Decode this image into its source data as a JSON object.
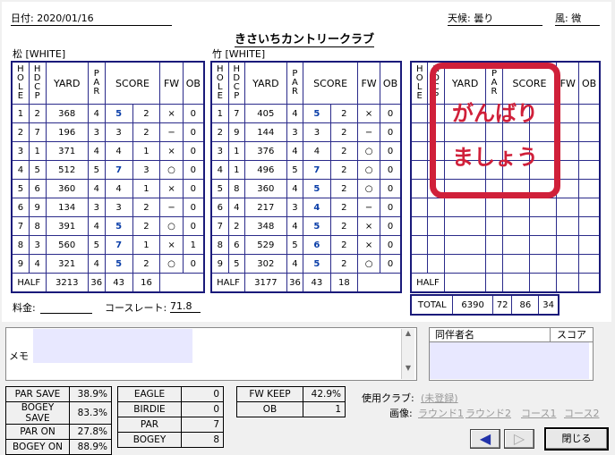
{
  "header": {
    "date_label": "日付: 2020/01/16",
    "weather_label": "天候: 曇り",
    "wind_label": "風: 微",
    "club_name": "きさいちカントリークラブ"
  },
  "course1": {
    "name": "松 [WHITE]",
    "rows": [
      {
        "hole": "1",
        "hdcp": "2",
        "yard": "368",
        "par": "4",
        "score": "5",
        "putt": "2",
        "fw": "×",
        "ob": "0",
        "blue": true
      },
      {
        "hole": "2",
        "hdcp": "7",
        "yard": "196",
        "par": "3",
        "score": "3",
        "putt": "2",
        "fw": "−",
        "ob": "0",
        "blue": false
      },
      {
        "hole": "3",
        "hdcp": "1",
        "yard": "371",
        "par": "4",
        "score": "4",
        "putt": "1",
        "fw": "×",
        "ob": "0",
        "blue": false
      },
      {
        "hole": "4",
        "hdcp": "5",
        "yard": "512",
        "par": "5",
        "score": "7",
        "putt": "3",
        "fw": "○",
        "ob": "0",
        "blue": true
      },
      {
        "hole": "5",
        "hdcp": "6",
        "yard": "360",
        "par": "4",
        "score": "4",
        "putt": "1",
        "fw": "×",
        "ob": "0",
        "blue": false
      },
      {
        "hole": "6",
        "hdcp": "9",
        "yard": "134",
        "par": "3",
        "score": "3",
        "putt": "2",
        "fw": "−",
        "ob": "0",
        "blue": false
      },
      {
        "hole": "7",
        "hdcp": "8",
        "yard": "391",
        "par": "4",
        "score": "5",
        "putt": "2",
        "fw": "○",
        "ob": "0",
        "blue": true
      },
      {
        "hole": "8",
        "hdcp": "3",
        "yard": "560",
        "par": "5",
        "score": "7",
        "putt": "1",
        "fw": "×",
        "ob": "1",
        "blue": true
      },
      {
        "hole": "9",
        "hdcp": "4",
        "yard": "321",
        "par": "4",
        "score": "5",
        "putt": "2",
        "fw": "○",
        "ob": "0",
        "blue": true
      }
    ],
    "half": {
      "label": "HALF",
      "yard": "3213",
      "par": "36",
      "score": "43",
      "putt": "16"
    }
  },
  "course2": {
    "name": "竹 [WHITE]",
    "rows": [
      {
        "hole": "1",
        "hdcp": "7",
        "yard": "405",
        "par": "4",
        "score": "5",
        "putt": "2",
        "fw": "×",
        "ob": "0",
        "blue": true
      },
      {
        "hole": "2",
        "hdcp": "9",
        "yard": "144",
        "par": "3",
        "score": "3",
        "putt": "2",
        "fw": "−",
        "ob": "0",
        "blue": false
      },
      {
        "hole": "3",
        "hdcp": "1",
        "yard": "376",
        "par": "4",
        "score": "4",
        "putt": "2",
        "fw": "○",
        "ob": "0",
        "blue": false
      },
      {
        "hole": "4",
        "hdcp": "1",
        "yard": "496",
        "par": "5",
        "score": "7",
        "putt": "2",
        "fw": "○",
        "ob": "0",
        "blue": true
      },
      {
        "hole": "5",
        "hdcp": "8",
        "yard": "360",
        "par": "4",
        "score": "5",
        "putt": "2",
        "fw": "○",
        "ob": "0",
        "blue": true
      },
      {
        "hole": "6",
        "hdcp": "4",
        "yard": "217",
        "par": "3",
        "score": "4",
        "putt": "2",
        "fw": "−",
        "ob": "0",
        "blue": true
      },
      {
        "hole": "7",
        "hdcp": "2",
        "yard": "348",
        "par": "4",
        "score": "5",
        "putt": "2",
        "fw": "×",
        "ob": "0",
        "blue": true
      },
      {
        "hole": "8",
        "hdcp": "6",
        "yard": "529",
        "par": "5",
        "score": "6",
        "putt": "2",
        "fw": "×",
        "ob": "0",
        "blue": true
      },
      {
        "hole": "9",
        "hdcp": "5",
        "yard": "302",
        "par": "4",
        "score": "5",
        "putt": "2",
        "fw": "○",
        "ob": "0",
        "blue": true
      }
    ],
    "half": {
      "label": "HALF",
      "yard": "3177",
      "par": "36",
      "score": "43",
      "putt": "18"
    }
  },
  "course3": {
    "half_label": "HALF",
    "total": {
      "label": "TOTAL",
      "yard": "6390",
      "par": "72",
      "score": "86",
      "putt": "34"
    }
  },
  "columns": {
    "hole": "HOLE",
    "hdcp": "HDCP",
    "yard": "YARD",
    "par": "PAR",
    "score": "SCORE",
    "fw": "FW",
    "ob": "OB"
  },
  "stamp": {
    "line1": "がんばり",
    "line2": "ましょう"
  },
  "footer_left": {
    "fee_label": "料金:",
    "rating_label": "コースレート:",
    "rating_value": "71.8"
  },
  "memo_label": "メモ",
  "companions": {
    "col_name": "同伴者名",
    "col_score": "スコア"
  },
  "stats": {
    "left": [
      {
        "label": "PAR SAVE",
        "value": "38.9%"
      },
      {
        "label": "BOGEY SAVE",
        "value": "83.3%"
      },
      {
        "label": "PAR ON",
        "value": "27.8%"
      },
      {
        "label": "BOGEY ON",
        "value": "88.9%"
      }
    ],
    "mid": [
      {
        "label": "EAGLE",
        "value": "0"
      },
      {
        "label": "BIRDIE",
        "value": "0"
      },
      {
        "label": "PAR",
        "value": "7"
      },
      {
        "label": "BOGEY",
        "value": "8"
      }
    ],
    "right": [
      {
        "label": "FW KEEP",
        "value": "42.9%"
      },
      {
        "label": "OB",
        "value": "1"
      }
    ]
  },
  "club_used": {
    "label": "使用クラブ:",
    "value": "(未登録)"
  },
  "images": {
    "label": "画像:",
    "round1": "ラウンド1",
    "round2": "ラウンド2",
    "course1": "コース1",
    "course2": "コース2"
  },
  "buttons": {
    "close": "閉じる"
  },
  "colors": {
    "accent_blue": "#0a3ea8",
    "stamp_red": "#d0203a",
    "table_border": "#1a1a7a"
  }
}
